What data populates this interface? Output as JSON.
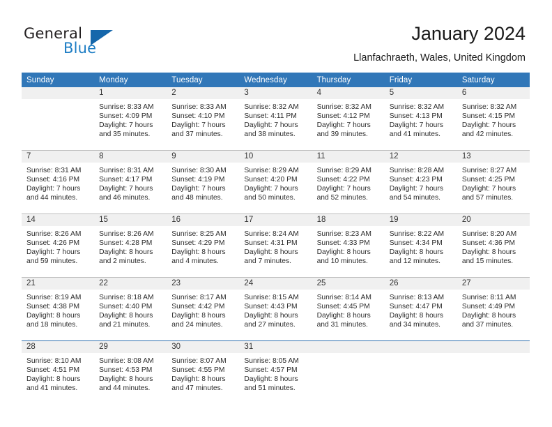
{
  "brand": {
    "name_part1": "General",
    "name_part2": "Blue",
    "logo_icon": "triangle-flag-icon",
    "accent_color": "#1d7dc4"
  },
  "header": {
    "month_title": "January 2024",
    "location": "Llanfachraeth, Wales, United Kingdom"
  },
  "calendar": {
    "header_background": "#3177b8",
    "daynum_background": "#f0f0f0",
    "weekday_headers": [
      "Sunday",
      "Monday",
      "Tuesday",
      "Wednesday",
      "Thursday",
      "Friday",
      "Saturday"
    ],
    "weeks": [
      {
        "days": [
          {
            "num": "",
            "sunrise": "",
            "sunset": "",
            "daylight_line1": "",
            "daylight_line2": "",
            "empty": true
          },
          {
            "num": "1",
            "sunrise": "Sunrise: 8:33 AM",
            "sunset": "Sunset: 4:09 PM",
            "daylight_line1": "Daylight: 7 hours",
            "daylight_line2": "and 35 minutes.",
            "empty": false
          },
          {
            "num": "2",
            "sunrise": "Sunrise: 8:33 AM",
            "sunset": "Sunset: 4:10 PM",
            "daylight_line1": "Daylight: 7 hours",
            "daylight_line2": "and 37 minutes.",
            "empty": false
          },
          {
            "num": "3",
            "sunrise": "Sunrise: 8:32 AM",
            "sunset": "Sunset: 4:11 PM",
            "daylight_line1": "Daylight: 7 hours",
            "daylight_line2": "and 38 minutes.",
            "empty": false
          },
          {
            "num": "4",
            "sunrise": "Sunrise: 8:32 AM",
            "sunset": "Sunset: 4:12 PM",
            "daylight_line1": "Daylight: 7 hours",
            "daylight_line2": "and 39 minutes.",
            "empty": false
          },
          {
            "num": "5",
            "sunrise": "Sunrise: 8:32 AM",
            "sunset": "Sunset: 4:13 PM",
            "daylight_line1": "Daylight: 7 hours",
            "daylight_line2": "and 41 minutes.",
            "empty": false
          },
          {
            "num": "6",
            "sunrise": "Sunrise: 8:32 AM",
            "sunset": "Sunset: 4:15 PM",
            "daylight_line1": "Daylight: 7 hours",
            "daylight_line2": "and 42 minutes.",
            "empty": false
          }
        ]
      },
      {
        "days": [
          {
            "num": "7",
            "sunrise": "Sunrise: 8:31 AM",
            "sunset": "Sunset: 4:16 PM",
            "daylight_line1": "Daylight: 7 hours",
            "daylight_line2": "and 44 minutes.",
            "empty": false
          },
          {
            "num": "8",
            "sunrise": "Sunrise: 8:31 AM",
            "sunset": "Sunset: 4:17 PM",
            "daylight_line1": "Daylight: 7 hours",
            "daylight_line2": "and 46 minutes.",
            "empty": false
          },
          {
            "num": "9",
            "sunrise": "Sunrise: 8:30 AM",
            "sunset": "Sunset: 4:19 PM",
            "daylight_line1": "Daylight: 7 hours",
            "daylight_line2": "and 48 minutes.",
            "empty": false
          },
          {
            "num": "10",
            "sunrise": "Sunrise: 8:29 AM",
            "sunset": "Sunset: 4:20 PM",
            "daylight_line1": "Daylight: 7 hours",
            "daylight_line2": "and 50 minutes.",
            "empty": false
          },
          {
            "num": "11",
            "sunrise": "Sunrise: 8:29 AM",
            "sunset": "Sunset: 4:22 PM",
            "daylight_line1": "Daylight: 7 hours",
            "daylight_line2": "and 52 minutes.",
            "empty": false
          },
          {
            "num": "12",
            "sunrise": "Sunrise: 8:28 AM",
            "sunset": "Sunset: 4:23 PM",
            "daylight_line1": "Daylight: 7 hours",
            "daylight_line2": "and 54 minutes.",
            "empty": false
          },
          {
            "num": "13",
            "sunrise": "Sunrise: 8:27 AM",
            "sunset": "Sunset: 4:25 PM",
            "daylight_line1": "Daylight: 7 hours",
            "daylight_line2": "and 57 minutes.",
            "empty": false
          }
        ]
      },
      {
        "days": [
          {
            "num": "14",
            "sunrise": "Sunrise: 8:26 AM",
            "sunset": "Sunset: 4:26 PM",
            "daylight_line1": "Daylight: 7 hours",
            "daylight_line2": "and 59 minutes.",
            "empty": false
          },
          {
            "num": "15",
            "sunrise": "Sunrise: 8:26 AM",
            "sunset": "Sunset: 4:28 PM",
            "daylight_line1": "Daylight: 8 hours",
            "daylight_line2": "and 2 minutes.",
            "empty": false
          },
          {
            "num": "16",
            "sunrise": "Sunrise: 8:25 AM",
            "sunset": "Sunset: 4:29 PM",
            "daylight_line1": "Daylight: 8 hours",
            "daylight_line2": "and 4 minutes.",
            "empty": false
          },
          {
            "num": "17",
            "sunrise": "Sunrise: 8:24 AM",
            "sunset": "Sunset: 4:31 PM",
            "daylight_line1": "Daylight: 8 hours",
            "daylight_line2": "and 7 minutes.",
            "empty": false
          },
          {
            "num": "18",
            "sunrise": "Sunrise: 8:23 AM",
            "sunset": "Sunset: 4:33 PM",
            "daylight_line1": "Daylight: 8 hours",
            "daylight_line2": "and 10 minutes.",
            "empty": false
          },
          {
            "num": "19",
            "sunrise": "Sunrise: 8:22 AM",
            "sunset": "Sunset: 4:34 PM",
            "daylight_line1": "Daylight: 8 hours",
            "daylight_line2": "and 12 minutes.",
            "empty": false
          },
          {
            "num": "20",
            "sunrise": "Sunrise: 8:20 AM",
            "sunset": "Sunset: 4:36 PM",
            "daylight_line1": "Daylight: 8 hours",
            "daylight_line2": "and 15 minutes.",
            "empty": false
          }
        ]
      },
      {
        "days": [
          {
            "num": "21",
            "sunrise": "Sunrise: 8:19 AM",
            "sunset": "Sunset: 4:38 PM",
            "daylight_line1": "Daylight: 8 hours",
            "daylight_line2": "and 18 minutes.",
            "empty": false
          },
          {
            "num": "22",
            "sunrise": "Sunrise: 8:18 AM",
            "sunset": "Sunset: 4:40 PM",
            "daylight_line1": "Daylight: 8 hours",
            "daylight_line2": "and 21 minutes.",
            "empty": false
          },
          {
            "num": "23",
            "sunrise": "Sunrise: 8:17 AM",
            "sunset": "Sunset: 4:42 PM",
            "daylight_line1": "Daylight: 8 hours",
            "daylight_line2": "and 24 minutes.",
            "empty": false
          },
          {
            "num": "24",
            "sunrise": "Sunrise: 8:15 AM",
            "sunset": "Sunset: 4:43 PM",
            "daylight_line1": "Daylight: 8 hours",
            "daylight_line2": "and 27 minutes.",
            "empty": false
          },
          {
            "num": "25",
            "sunrise": "Sunrise: 8:14 AM",
            "sunset": "Sunset: 4:45 PM",
            "daylight_line1": "Daylight: 8 hours",
            "daylight_line2": "and 31 minutes.",
            "empty": false
          },
          {
            "num": "26",
            "sunrise": "Sunrise: 8:13 AM",
            "sunset": "Sunset: 4:47 PM",
            "daylight_line1": "Daylight: 8 hours",
            "daylight_line2": "and 34 minutes.",
            "empty": false
          },
          {
            "num": "27",
            "sunrise": "Sunrise: 8:11 AM",
            "sunset": "Sunset: 4:49 PM",
            "daylight_line1": "Daylight: 8 hours",
            "daylight_line2": "and 37 minutes.",
            "empty": false
          }
        ]
      },
      {
        "days": [
          {
            "num": "28",
            "sunrise": "Sunrise: 8:10 AM",
            "sunset": "Sunset: 4:51 PM",
            "daylight_line1": "Daylight: 8 hours",
            "daylight_line2": "and 41 minutes.",
            "empty": false
          },
          {
            "num": "29",
            "sunrise": "Sunrise: 8:08 AM",
            "sunset": "Sunset: 4:53 PM",
            "daylight_line1": "Daylight: 8 hours",
            "daylight_line2": "and 44 minutes.",
            "empty": false
          },
          {
            "num": "30",
            "sunrise": "Sunrise: 8:07 AM",
            "sunset": "Sunset: 4:55 PM",
            "daylight_line1": "Daylight: 8 hours",
            "daylight_line2": "and 47 minutes.",
            "empty": false
          },
          {
            "num": "31",
            "sunrise": "Sunrise: 8:05 AM",
            "sunset": "Sunset: 4:57 PM",
            "daylight_line1": "Daylight: 8 hours",
            "daylight_line2": "and 51 minutes.",
            "empty": false
          },
          {
            "num": "",
            "sunrise": "",
            "sunset": "",
            "daylight_line1": "",
            "daylight_line2": "",
            "empty": true
          },
          {
            "num": "",
            "sunrise": "",
            "sunset": "",
            "daylight_line1": "",
            "daylight_line2": "",
            "empty": true
          },
          {
            "num": "",
            "sunrise": "",
            "sunset": "",
            "daylight_line1": "",
            "daylight_line2": "",
            "empty": true
          }
        ]
      }
    ]
  }
}
